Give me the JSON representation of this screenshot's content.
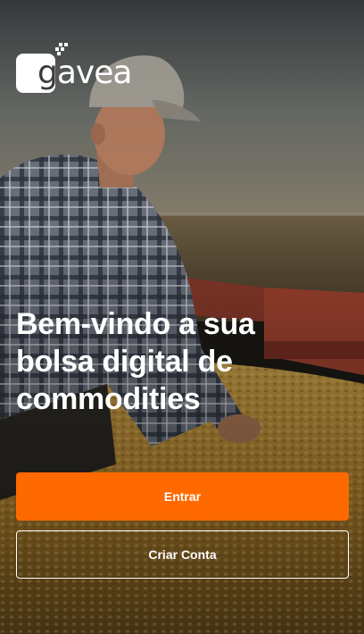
{
  "brand": {
    "name_lead": "g",
    "name_rest": "avea",
    "accent_color": "#ff6a00"
  },
  "hero": {
    "headline": "Bem-vindo a sua bolsa digital de commodities"
  },
  "actions": {
    "primary_label": "Entrar",
    "secondary_label": "Criar Conta"
  }
}
